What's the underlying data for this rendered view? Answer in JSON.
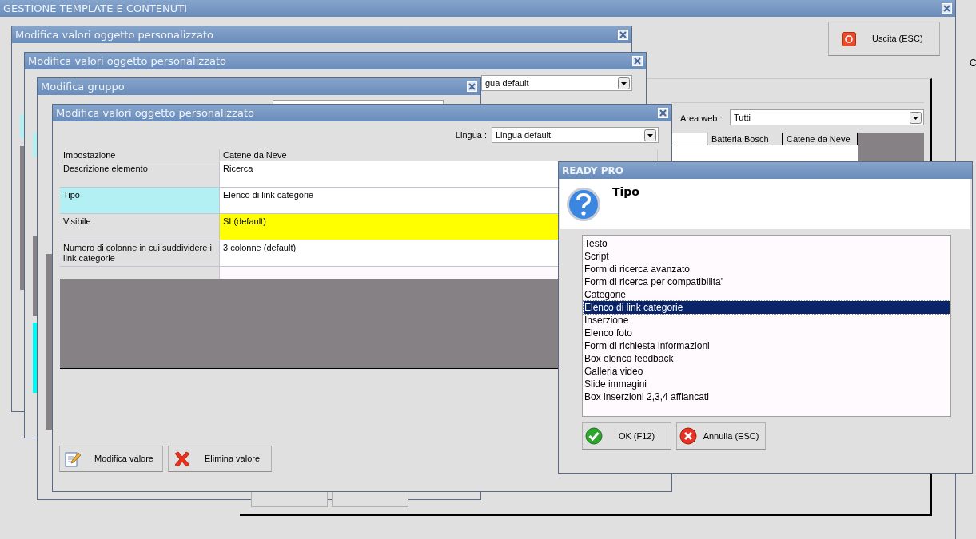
{
  "main_window": {
    "title": "GESTIONE TEMPLATE E CONTENUTI",
    "exit_button": "Uscita (ESC)",
    "area_web": {
      "label": "Area web :",
      "value": "Tutti"
    },
    "columns": [
      "Batteria Bosch",
      "Catene da Neve"
    ],
    "side_text": "C"
  },
  "background_windows": [
    {
      "title": "Modifica valori oggetto personalizzato"
    },
    {
      "title": "Modifica valori oggetto personalizzato",
      "language_value": "gua default"
    },
    {
      "title": "Modifica gruppo"
    }
  ],
  "editor_window": {
    "title": "Modifica valori oggetto personalizzato",
    "language": {
      "label": "Lingua :",
      "value": "Lingua default"
    },
    "columns": [
      "Impostazione",
      "Catene da Neve"
    ],
    "rows": [
      {
        "setting": "Descrizione elemento",
        "value": "Ricerca",
        "selected": false,
        "highlighted": false
      },
      {
        "setting": "Tipo",
        "value": "Elenco di link categorie",
        "selected": true,
        "highlighted": false
      },
      {
        "setting": "Visibile",
        "value": "SI (default)",
        "selected": false,
        "highlighted": true
      },
      {
        "setting": "Numero di colonne in cui suddividere i link categorie",
        "value": "3 colonne (default)",
        "selected": false,
        "highlighted": false
      }
    ],
    "buttons": [
      {
        "kind": "edit",
        "label": "Modifica valore"
      },
      {
        "kind": "delete",
        "label": "Elimina valore"
      }
    ]
  },
  "dialog": {
    "title": "READY PRO",
    "heading": "Tipo",
    "options": [
      {
        "label": "Testo",
        "selected": false
      },
      {
        "label": "Script",
        "selected": false
      },
      {
        "label": "Form di ricerca avanzato",
        "selected": false
      },
      {
        "label": "Form di ricerca per compatibilita'",
        "selected": false
      },
      {
        "label": "Categorie",
        "selected": false
      },
      {
        "label": "Elenco di link categorie",
        "selected": true
      },
      {
        "label": "Inserzione",
        "selected": false
      },
      {
        "label": "Elenco foto",
        "selected": false
      },
      {
        "label": "Form di richiesta informazioni",
        "selected": false
      },
      {
        "label": "Box elenco feedback",
        "selected": false
      },
      {
        "label": "Galleria video",
        "selected": false
      },
      {
        "label": "Slide immagini",
        "selected": false
      },
      {
        "label": "Box inserzioni 2,3,4 affiancati",
        "selected": false
      }
    ],
    "buttons": [
      {
        "kind": "ok",
        "label": "OK (F12)"
      },
      {
        "kind": "cancel",
        "label": "Annulla (ESC)"
      }
    ]
  }
}
